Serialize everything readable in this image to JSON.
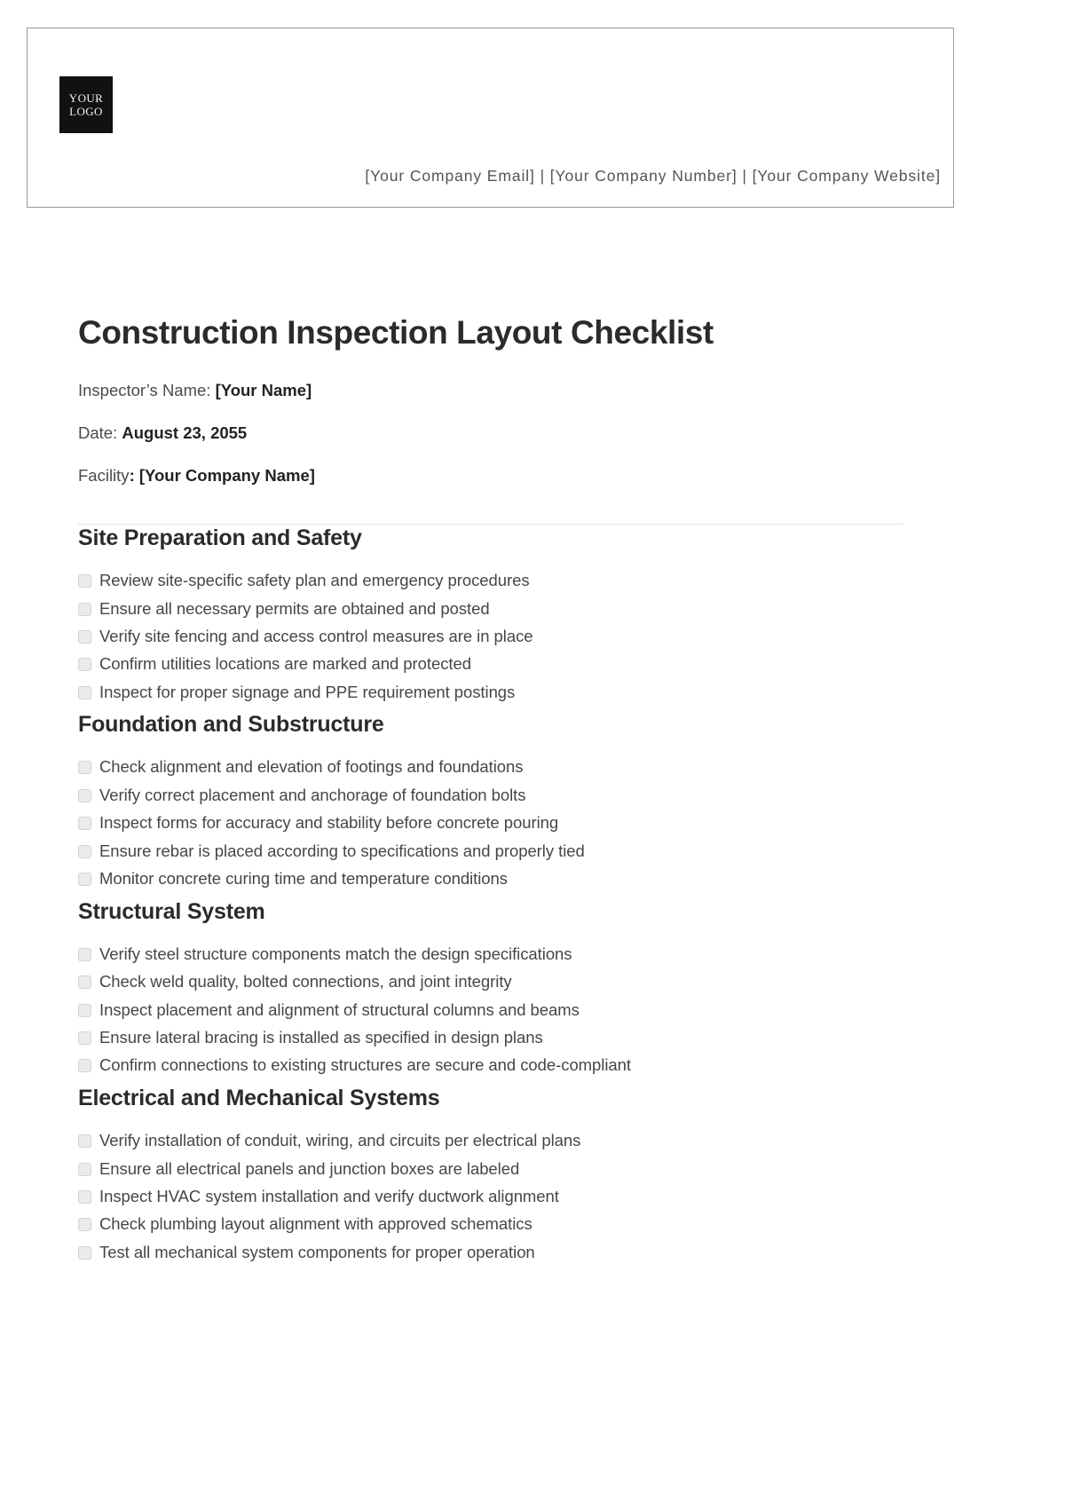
{
  "letterhead": {
    "logo": {
      "line1": "YOUR",
      "line2": "LOGO"
    },
    "contact": "[Your Company Email] | [Your Company Number] | [Your Company Website]"
  },
  "document": {
    "title": "Construction Inspection Layout Checklist",
    "meta": [
      {
        "label": "Inspector’s Name: ",
        "value": "[Your Name]"
      },
      {
        "label": "Date: ",
        "value": "August 23, 2055"
      },
      {
        "label": "Facility",
        "value": ": [Your Company Name]"
      }
    ]
  },
  "sections": [
    {
      "title": "Site Preparation and Safety",
      "items": [
        "Review site-specific safety plan and emergency procedures",
        "Ensure all necessary permits are obtained and posted",
        "Verify site fencing and access control measures are in place",
        "Confirm utilities locations are marked and protected",
        "Inspect for proper signage and PPE requirement postings"
      ]
    },
    {
      "title": "Foundation and Substructure",
      "items": [
        "Check alignment and elevation of footings and foundations",
        "Verify correct placement and anchorage of foundation bolts",
        "Inspect forms for accuracy and stability before concrete pouring",
        "Ensure rebar is placed according to specifications and properly tied",
        "Monitor concrete curing time and temperature conditions"
      ]
    },
    {
      "title": "Structural System",
      "items": [
        "Verify steel structure components match the design specifications",
        "Check weld quality, bolted connections, and joint integrity",
        "Inspect placement and alignment of structural columns and beams",
        "Ensure lateral bracing is installed as specified in design plans",
        "Confirm connections to existing structures are secure and code-compliant"
      ]
    },
    {
      "title": "Electrical and Mechanical Systems",
      "items": [
        "Verify installation of conduit, wiring, and circuits per electrical plans",
        "Ensure all electrical panels and junction boxes are labeled",
        "Inspect HVAC system installation and verify ductwork alignment",
        "Check plumbing layout alignment with approved schematics",
        "Test all mechanical system components for proper operation"
      ]
    }
  ],
  "colors": {
    "logo_background": "#111111",
    "heading_text": "#2b2b2b",
    "body_text": "#464646",
    "checkbox_fill": "#ebebeb",
    "checkbox_border": "#d4d4d4",
    "letterhead_border": "#9a9a9a",
    "divider": "#e2e2e2"
  }
}
